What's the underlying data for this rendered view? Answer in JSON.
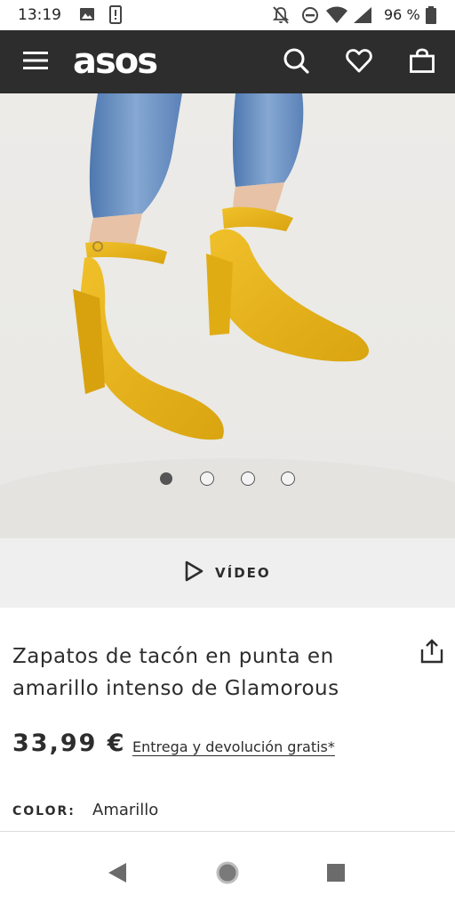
{
  "status_bar": {
    "time": "13:19",
    "battery": "96 %"
  },
  "header": {
    "logo": "asos",
    "icons": [
      "menu-icon",
      "search-icon",
      "heart-icon",
      "bag-icon"
    ]
  },
  "product": {
    "image_description_icon": "product-photo",
    "carousel": {
      "count": 4,
      "active_index": 0
    },
    "video_label": "VÍDEO",
    "title": "Zapatos de tacón en punta en amarillo intenso de Glamorous",
    "price": "33,99 €",
    "delivery_text": "Entrega y devolución gratis*",
    "color_label": "COLOR:",
    "color_value": "Amarillo"
  },
  "colors": {
    "header_bg": "#2d2d2d",
    "shoe_yellow": "#e8b21a",
    "denim": "#6f94c4"
  }
}
